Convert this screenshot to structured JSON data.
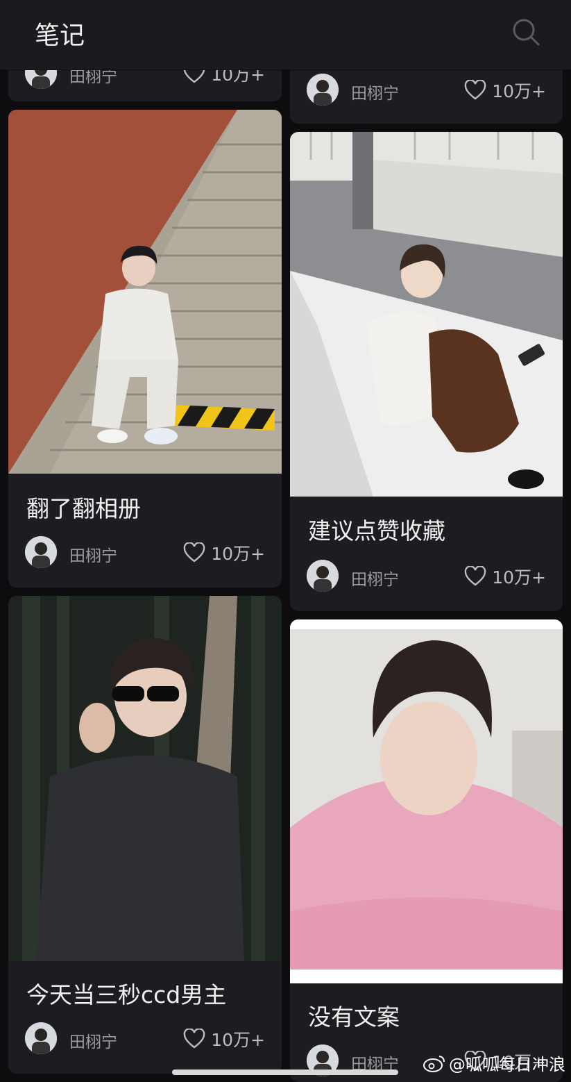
{
  "header": {
    "title": "笔记",
    "search_icon": "search-icon"
  },
  "notes": [
    {
      "id": "top-left-partial",
      "author": "田栩宁",
      "likes": "10万+"
    },
    {
      "id": "top-right-partial",
      "author": "田栩宁",
      "likes": "10万+"
    },
    {
      "id": "stairs",
      "title": "翻了翻相册",
      "author": "田栩宁",
      "likes": "10万+"
    },
    {
      "id": "white-room",
      "title": "建议点赞收藏",
      "author": "田栩宁",
      "likes": "10万+"
    },
    {
      "id": "forest",
      "title": "今天当三秒ccd男主",
      "author": "田栩宁",
      "likes": "10万+"
    },
    {
      "id": "pink",
      "title": "没有文案",
      "author": "田栩宁",
      "likes": "10万+"
    }
  ],
  "watermark": "@呱呱每日冲浪",
  "colors": {
    "background": "#0d0d10",
    "card": "#1c1c21",
    "topbar": "#1b1b1f"
  }
}
